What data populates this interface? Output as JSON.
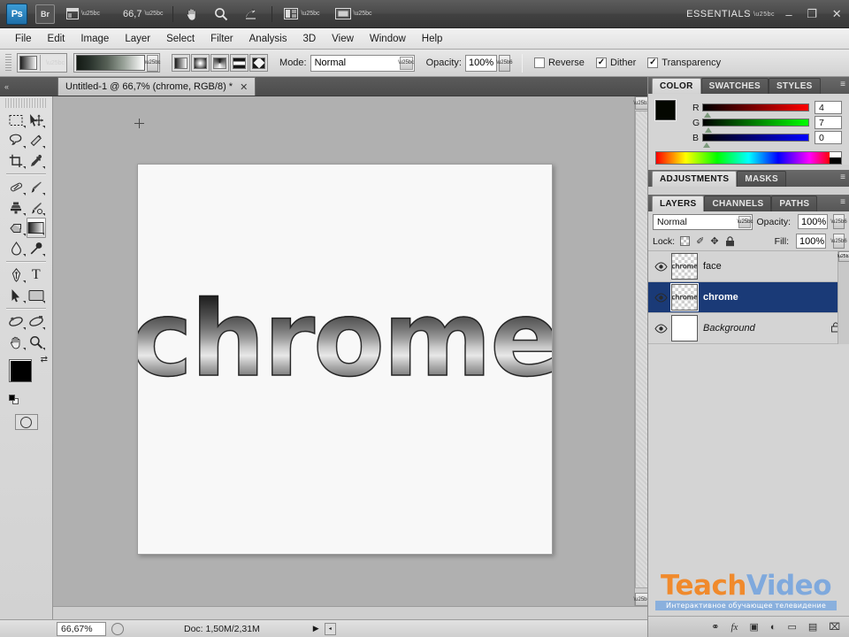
{
  "app": {
    "logo": "Ps",
    "bridge_label": "Br",
    "view_extras_icon": "view-extras-icon",
    "zoom_level": "66,7",
    "hand_tool_icon": "hand-icon",
    "zoom_tool_icon": "magnifier-icon",
    "rotate_view_icon": "rotate-view-icon",
    "arrange_documents_icon": "arrange-documents-icon",
    "screen_mode_icon": "screen-mode-icon",
    "workspace": "ESSENTIALS",
    "minimize": "–",
    "restore": "❐",
    "close": "✕"
  },
  "menu": {
    "items": [
      {
        "label": "File"
      },
      {
        "label": "Edit"
      },
      {
        "label": "Image"
      },
      {
        "label": "Layer"
      },
      {
        "label": "Select"
      },
      {
        "label": "Filter"
      },
      {
        "label": "Analysis"
      },
      {
        "label": "3D"
      },
      {
        "label": "View"
      },
      {
        "label": "Window"
      },
      {
        "label": "Help"
      }
    ]
  },
  "options_bar": {
    "tool_preset_name": "gradient-tool-preset",
    "gradient_picker_name": "gradient-preset-picker",
    "gradient_types": [
      {
        "name": "linear-gradient-button",
        "selected": true
      },
      {
        "name": "radial-gradient-button",
        "selected": false
      },
      {
        "name": "angle-gradient-button",
        "selected": false
      },
      {
        "name": "reflected-gradient-button",
        "selected": false
      },
      {
        "name": "diamond-gradient-button",
        "selected": false
      }
    ],
    "mode_label": "Mode:",
    "mode_value": "Normal",
    "opacity_label": "Opacity:",
    "opacity_value": "100%",
    "reverse_label": "Reverse",
    "reverse_checked": "",
    "dither_label": "Dither",
    "dither_checked": "✓",
    "transparency_label": "Transparency",
    "transparency_checked": "✓"
  },
  "document_tab": {
    "title": "Untitled-1 @ 66,7% (chrome, RGB/8) *",
    "close_glyph": "✕",
    "collapse_glyph": "«"
  },
  "toolbox": {
    "tools": [
      {
        "name": "rectangular-marquee-tool",
        "selected": false
      },
      {
        "name": "move-tool",
        "selected": false
      },
      {
        "name": "lasso-tool",
        "selected": false
      },
      {
        "name": "magic-wand-tool",
        "selected": false
      },
      {
        "name": "crop-tool",
        "selected": false
      },
      {
        "name": "eyedropper-tool",
        "selected": false
      },
      {
        "name": "healing-brush-tool",
        "selected": false
      },
      {
        "name": "brush-tool",
        "selected": false
      },
      {
        "name": "clone-stamp-tool",
        "selected": false
      },
      {
        "name": "history-brush-tool",
        "selected": false
      },
      {
        "name": "eraser-tool",
        "selected": false
      },
      {
        "name": "gradient-tool",
        "selected": true
      },
      {
        "name": "blur-tool",
        "selected": false
      },
      {
        "name": "dodge-tool",
        "selected": false
      },
      {
        "name": "pen-tool",
        "selected": false
      },
      {
        "name": "type-tool",
        "selected": false
      },
      {
        "name": "path-selection-tool",
        "selected": false
      },
      {
        "name": "rectangle-shape-tool",
        "selected": false
      },
      {
        "name": "3d-rotate-tool",
        "selected": false
      },
      {
        "name": "3d-orbit-tool",
        "selected": false
      },
      {
        "name": "hand-tool",
        "selected": false
      },
      {
        "name": "zoom-tool",
        "selected": false
      }
    ],
    "foreground_color": "#000000",
    "background_color": "#ffffff",
    "swap_glyph": "⇄",
    "type_tool_glyph": "T",
    "quick_mask_name": "quick-mask-button"
  },
  "canvas": {
    "artwork_text": "chrome",
    "paper_color": "#f8f8f8",
    "workspace_color": "#b0b0b0"
  },
  "status_bar": {
    "zoom": "66,67%",
    "doc_info": "Doc: 1,50M/2,31M",
    "play_glyph": "▶",
    "handle_glyph": "◂"
  },
  "color_panel": {
    "tabs": [
      {
        "label": "COLOR",
        "active": true
      },
      {
        "label": "SWATCHES",
        "active": false
      },
      {
        "label": "STYLES",
        "active": false
      }
    ],
    "foreground": "#040700",
    "background": "#ffffff",
    "channels": [
      {
        "label": "R",
        "value": "4"
      },
      {
        "label": "G",
        "value": "7"
      },
      {
        "label": "B",
        "value": "0"
      }
    ],
    "menu_glyph": "≡"
  },
  "adjustments_panel": {
    "tabs": [
      {
        "label": "ADJUSTMENTS",
        "active": true
      },
      {
        "label": "MASKS",
        "active": false
      }
    ],
    "menu_glyph": "≡"
  },
  "layers_panel": {
    "tabs": [
      {
        "label": "LAYERS",
        "active": true
      },
      {
        "label": "CHANNELS",
        "active": false
      },
      {
        "label": "PATHS",
        "active": false
      }
    ],
    "blend_mode": "Normal",
    "opacity_label": "Opacity:",
    "opacity_value": "100%",
    "lock_label": "Lock:",
    "lock_transparent_name": "lock-transparent-pixels",
    "lock_image_glyph": "✐",
    "lock_position_glyph": "✥",
    "lock_all_glyph": "␣",
    "fill_label": "Fill:",
    "fill_value": "100%",
    "menu_glyph": "≡",
    "layers": [
      {
        "name": "face",
        "selected": false,
        "visible": true,
        "locked": false,
        "thumb_text": "chrome",
        "italic": false
      },
      {
        "name": "chrome",
        "selected": true,
        "visible": true,
        "locked": false,
        "thumb_text": "chrome",
        "italic": false
      },
      {
        "name": "Background",
        "selected": false,
        "visible": true,
        "locked": true,
        "thumb_text": "",
        "italic": true
      }
    ],
    "footer_icons": [
      {
        "name": "link-layers-icon",
        "glyph": "⚭"
      },
      {
        "name": "layer-style-fx-icon",
        "glyph": "fx"
      },
      {
        "name": "add-layer-mask-icon",
        "glyph": "▣"
      },
      {
        "name": "new-adjustment-layer-icon",
        "glyph": "◐"
      },
      {
        "name": "new-group-icon",
        "glyph": "▭"
      },
      {
        "name": "new-layer-icon",
        "glyph": "▤"
      },
      {
        "name": "delete-layer-icon",
        "glyph": "⌧"
      }
    ]
  },
  "watermark": {
    "part1": "Teach",
    "part2": "Video",
    "tagline": "Интерактивное обучающее телевидение",
    "color_orange": "#f08a2c",
    "color_blue": "#7fa9dd"
  }
}
